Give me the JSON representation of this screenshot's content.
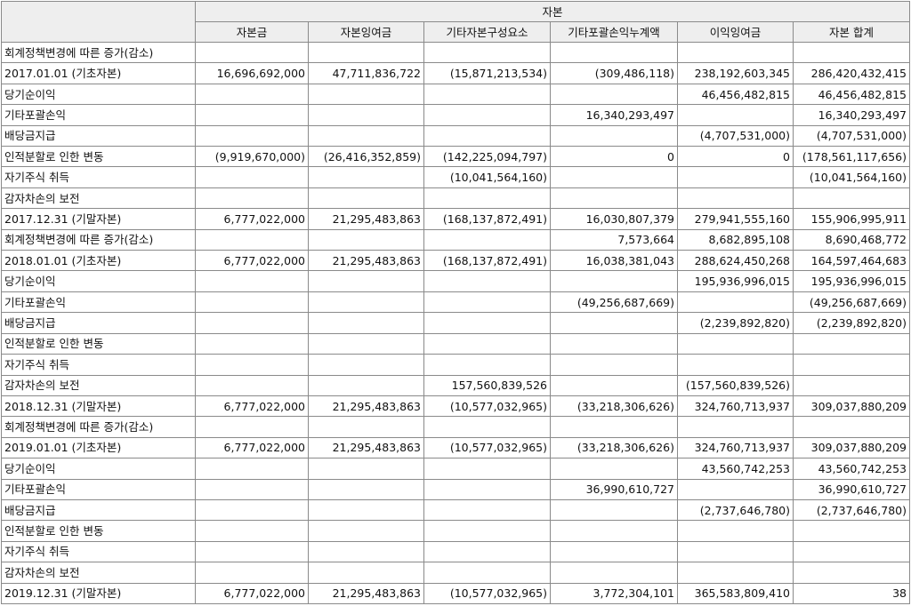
{
  "table": {
    "group_header": "자본",
    "columns": [
      "자본금",
      "자본잉여금",
      "기타자본구성요소",
      "기타포괄손익누계액",
      "이익잉여금",
      "자본 합계"
    ],
    "rows": [
      {
        "label": "회계정책변경에 따른 증가(감소)",
        "values": [
          "",
          "",
          "",
          "",
          "",
          ""
        ]
      },
      {
        "label": "2017.01.01 (기초자본)",
        "values": [
          "16,696,692,000",
          "47,711,836,722",
          "(15,871,213,534)",
          "(309,486,118)",
          "238,192,603,345",
          "286,420,432,415"
        ]
      },
      {
        "label": "당기순이익",
        "values": [
          "",
          "",
          "",
          "",
          "46,456,482,815",
          "46,456,482,815"
        ]
      },
      {
        "label": "기타포괄손익",
        "values": [
          "",
          "",
          "",
          "16,340,293,497",
          "",
          "16,340,293,497"
        ]
      },
      {
        "label": "배당금지급",
        "values": [
          "",
          "",
          "",
          "",
          "(4,707,531,000)",
          "(4,707,531,000)"
        ]
      },
      {
        "label": "인적분할로 인한 변동",
        "values": [
          "(9,919,670,000)",
          "(26,416,352,859)",
          "(142,225,094,797)",
          "0",
          "0",
          "(178,561,117,656)"
        ]
      },
      {
        "label": "자기주식 취득",
        "values": [
          "",
          "",
          "(10,041,564,160)",
          "",
          "",
          "(10,041,564,160)"
        ]
      },
      {
        "label": "감자차손의 보전",
        "values": [
          "",
          "",
          "",
          "",
          "",
          ""
        ]
      },
      {
        "label": "2017.12.31 (기말자본)",
        "values": [
          "6,777,022,000",
          "21,295,483,863",
          "(168,137,872,491)",
          "16,030,807,379",
          "279,941,555,160",
          "155,906,995,911"
        ]
      },
      {
        "label": "회계정책변경에 따른 증가(감소)",
        "values": [
          "",
          "",
          "",
          "7,573,664",
          "8,682,895,108",
          "8,690,468,772"
        ]
      },
      {
        "label": "2018.01.01 (기초자본)",
        "values": [
          "6,777,022,000",
          "21,295,483,863",
          "(168,137,872,491)",
          "16,038,381,043",
          "288,624,450,268",
          "164,597,464,683"
        ]
      },
      {
        "label": "당기순이익",
        "values": [
          "",
          "",
          "",
          "",
          "195,936,996,015",
          "195,936,996,015"
        ]
      },
      {
        "label": "기타포괄손익",
        "values": [
          "",
          "",
          "",
          "(49,256,687,669)",
          "",
          "(49,256,687,669)"
        ]
      },
      {
        "label": "배당금지급",
        "values": [
          "",
          "",
          "",
          "",
          "(2,239,892,820)",
          "(2,239,892,820)"
        ]
      },
      {
        "label": "인적분할로 인한 변동",
        "values": [
          "",
          "",
          "",
          "",
          "",
          ""
        ]
      },
      {
        "label": "자기주식 취득",
        "values": [
          "",
          "",
          "",
          "",
          "",
          ""
        ]
      },
      {
        "label": "감자차손의 보전",
        "values": [
          "",
          "",
          "157,560,839,526",
          "",
          "(157,560,839,526)",
          ""
        ]
      },
      {
        "label": "2018.12.31 (기말자본)",
        "values": [
          "6,777,022,000",
          "21,295,483,863",
          "(10,577,032,965)",
          "(33,218,306,626)",
          "324,760,713,937",
          "309,037,880,209"
        ]
      },
      {
        "label": "회계정책변경에 따른 증가(감소)",
        "values": [
          "",
          "",
          "",
          "",
          "",
          ""
        ]
      },
      {
        "label": "2019.01.01 (기초자본)",
        "values": [
          "6,777,022,000",
          "21,295,483,863",
          "(10,577,032,965)",
          "(33,218,306,626)",
          "324,760,713,937",
          "309,037,880,209"
        ]
      },
      {
        "label": "당기순이익",
        "values": [
          "",
          "",
          "",
          "",
          "43,560,742,253",
          "43,560,742,253"
        ]
      },
      {
        "label": "기타포괄손익",
        "values": [
          "",
          "",
          "",
          "36,990,610,727",
          "",
          "36,990,610,727"
        ]
      },
      {
        "label": "배당금지급",
        "values": [
          "",
          "",
          "",
          "",
          "(2,737,646,780)",
          "(2,737,646,780)"
        ]
      },
      {
        "label": "인적분할로 인한 변동",
        "values": [
          "",
          "",
          "",
          "",
          "",
          ""
        ]
      },
      {
        "label": "자기주식 취득",
        "values": [
          "",
          "",
          "",
          "",
          "",
          ""
        ]
      },
      {
        "label": "감자차손의 보전",
        "values": [
          "",
          "",
          "",
          "",
          "",
          ""
        ]
      },
      {
        "label": "2019.12.31 (기말자본)",
        "values": [
          "6,777,022,000",
          "21,295,483,863",
          "(10,577,032,965)",
          "3,772,304,101",
          "365,583,809,410",
          "38"
        ]
      }
    ]
  }
}
